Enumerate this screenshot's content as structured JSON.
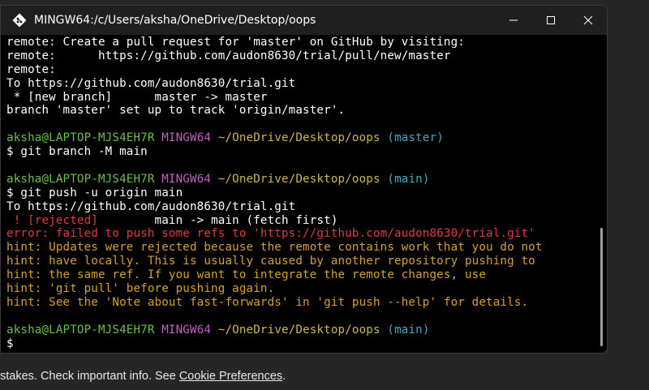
{
  "window": {
    "title": "MINGW64:/c/Users/aksha/OneDrive/Desktop/oops",
    "app_icon": "git-bash-icon",
    "controls": {
      "minimize_icon": "minimize-icon",
      "maximize_icon": "maximize-icon",
      "close_icon": "close-icon"
    }
  },
  "colors": {
    "background": "#000000",
    "titlebar": "#1f1f1f",
    "prompt_user": "#6cbf45",
    "prompt_env": "#c060c0",
    "prompt_path": "#c9b94a",
    "prompt_branch": "#45a8c0",
    "error": "#e03c3c",
    "hint": "#d6a02c"
  },
  "terminal": {
    "lines": [
      {
        "segments": [
          {
            "text": "remote: Create a pull request for 'master' on GitHub by visiting:",
            "color": "white"
          }
        ]
      },
      {
        "segments": [
          {
            "text": "remote:      https://github.com/audon8630/trial/pull/new/master",
            "color": "white"
          }
        ]
      },
      {
        "segments": [
          {
            "text": "remote:",
            "color": "white"
          }
        ]
      },
      {
        "segments": [
          {
            "text": "To https://github.com/audon8630/trial.git",
            "color": "white"
          }
        ]
      },
      {
        "segments": [
          {
            "text": " * [new branch]      master -> master",
            "color": "white"
          }
        ]
      },
      {
        "segments": [
          {
            "text": "branch 'master' set up to track 'origin/master'.",
            "color": "white"
          }
        ]
      },
      {
        "segments": [
          {
            "text": "",
            "color": "white"
          }
        ]
      },
      {
        "segments": [
          {
            "text": "aksha@LAPTOP-MJS4EH7R",
            "color": "green"
          },
          {
            "text": " ",
            "color": "white"
          },
          {
            "text": "MINGW64",
            "color": "magenta"
          },
          {
            "text": " ",
            "color": "white"
          },
          {
            "text": "~/OneDrive/Desktop/oops",
            "color": "yellow"
          },
          {
            "text": " ",
            "color": "white"
          },
          {
            "text": "(master)",
            "color": "cyan"
          }
        ]
      },
      {
        "segments": [
          {
            "text": "$ git branch -M main",
            "color": "white"
          }
        ]
      },
      {
        "segments": [
          {
            "text": "",
            "color": "white"
          }
        ]
      },
      {
        "segments": [
          {
            "text": "aksha@LAPTOP-MJS4EH7R",
            "color": "green"
          },
          {
            "text": " ",
            "color": "white"
          },
          {
            "text": "MINGW64",
            "color": "magenta"
          },
          {
            "text": " ",
            "color": "white"
          },
          {
            "text": "~/OneDrive/Desktop/oops",
            "color": "yellow"
          },
          {
            "text": " ",
            "color": "white"
          },
          {
            "text": "(main)",
            "color": "cyan"
          }
        ]
      },
      {
        "segments": [
          {
            "text": "$ git push -u origin main",
            "color": "white"
          }
        ]
      },
      {
        "segments": [
          {
            "text": "To https://github.com/audon8630/trial.git",
            "color": "white"
          }
        ]
      },
      {
        "segments": [
          {
            "text": " ! [rejected]",
            "color": "red"
          },
          {
            "text": "        main -> main (fetch first)",
            "color": "white"
          }
        ]
      },
      {
        "segments": [
          {
            "text": "error: failed to push some refs to 'https://github.com/audon8630/trial.git'",
            "color": "red"
          }
        ]
      },
      {
        "segments": [
          {
            "text": "hint: Updates were rejected because the remote contains work that you do not",
            "color": "orange"
          }
        ]
      },
      {
        "segments": [
          {
            "text": "hint: have locally. This is usually caused by another repository pushing to",
            "color": "orange"
          }
        ]
      },
      {
        "segments": [
          {
            "text": "hint: the same ref. If you want to integrate the remote changes, use",
            "color": "orange"
          }
        ]
      },
      {
        "segments": [
          {
            "text": "hint: 'git pull' before pushing again.",
            "color": "orange"
          }
        ]
      },
      {
        "segments": [
          {
            "text": "hint: See the 'Note about fast-forwards' in 'git push --help' for details.",
            "color": "orange"
          }
        ]
      },
      {
        "segments": [
          {
            "text": "",
            "color": "white"
          }
        ]
      },
      {
        "segments": [
          {
            "text": "aksha@LAPTOP-MJS4EH7R",
            "color": "green"
          },
          {
            "text": " ",
            "color": "white"
          },
          {
            "text": "MINGW64",
            "color": "magenta"
          },
          {
            "text": " ",
            "color": "white"
          },
          {
            "text": "~/OneDrive/Desktop/oops",
            "color": "yellow"
          },
          {
            "text": " ",
            "color": "white"
          },
          {
            "text": "(main)",
            "color": "cyan"
          }
        ]
      },
      {
        "segments": [
          {
            "text": "$",
            "color": "white"
          }
        ]
      }
    ]
  },
  "banner": {
    "text": "stakes. Check important info. See ",
    "link": "Cookie Preferences",
    "suffix": "."
  }
}
